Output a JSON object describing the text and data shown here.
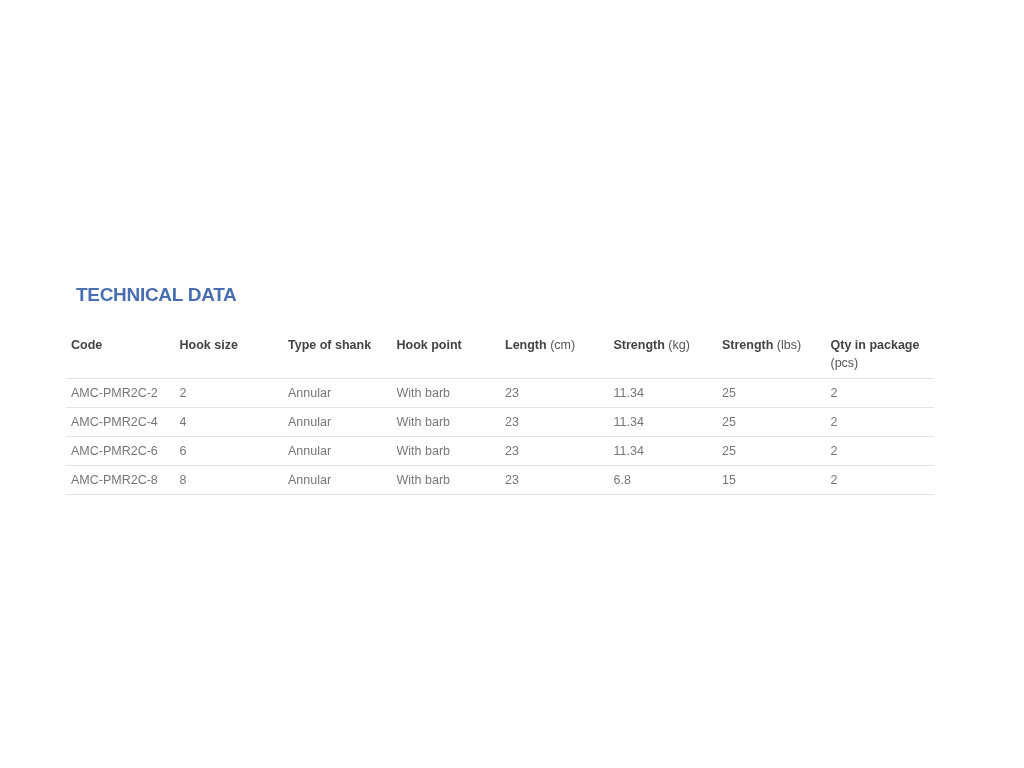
{
  "title": "TECHNICAL DATA",
  "table": {
    "columns": [
      "**Code**",
      "**Hook size**",
      "**Type of shank**",
      "**Hook point**",
      "**Length** (cm)",
      "**Strength** (kg)",
      "**Strength** (lbs)",
      "**Qty in package** (pcs)"
    ],
    "rows": [
      [
        "AMC-PMR2C-2",
        "2",
        "Annular",
        "With barb",
        "23",
        "11.34",
        "25",
        "2"
      ],
      [
        "AMC-PMR2C-4",
        "4",
        "Annular",
        "With barb",
        "23",
        "11.34",
        "25",
        "2"
      ],
      [
        "AMC-PMR2C-6",
        "6",
        "Annular",
        "With barb",
        "23",
        "11.34",
        "25",
        "2"
      ],
      [
        "AMC-PMR2C-8",
        "8",
        "Annular",
        "With barb",
        "23",
        "6.8",
        "15",
        "2"
      ]
    ]
  }
}
